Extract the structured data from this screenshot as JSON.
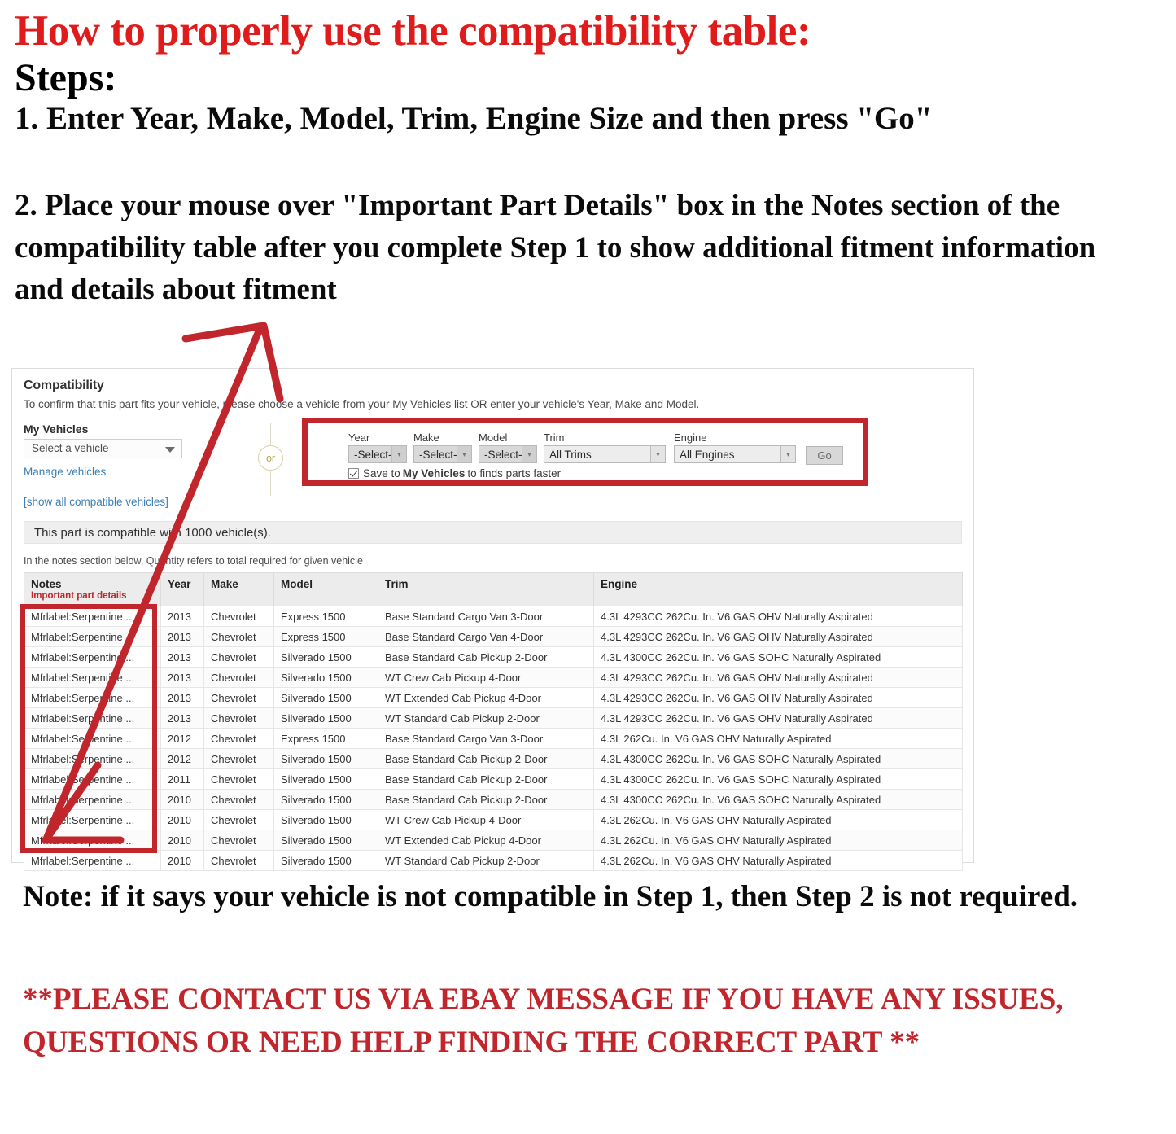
{
  "instructions": {
    "headline": "How to properly use the compatibility table:",
    "steps_label": "Steps:",
    "step_one": "1. Enter Year, Make, Model, Trim, Engine Size and then press \"Go\"",
    "step_two": "2. Place your mouse over \"Important Part Details\" box in the Notes section of the compatibility table after you complete Step 1 to show additional fitment information and details about fitment",
    "note": "Note: if it says your vehicle is not compatible in Step 1, then Step 2 is not required.",
    "contact": "**PLEASE CONTACT US VIA EBAY MESSAGE IF YOU HAVE ANY ISSUES, QUESTIONS OR NEED HELP FINDING THE CORRECT PART **"
  },
  "colors": {
    "red_accent": "#c0262b",
    "headline_red": "#e01b1b",
    "link_blue": "#3d7fb5",
    "banner_gray": "#efefef"
  },
  "compatibility": {
    "title": "Compatibility",
    "subtitle": "To confirm that this part fits your vehicle, please choose a vehicle from your My Vehicles list OR enter your vehicle's Year, Make and Model.",
    "my_vehicles": {
      "label": "My Vehicles",
      "select_value": "Select a vehicle",
      "manage_link": "Manage vehicles",
      "show_all_link": "[show all compatible vehicles]"
    },
    "or_divider": "or",
    "finder": {
      "year": {
        "label": "Year",
        "value": "-Select-"
      },
      "make": {
        "label": "Make",
        "value": "-Select-"
      },
      "model": {
        "label": "Model",
        "value": "-Select-"
      },
      "trim": {
        "label": "Trim",
        "value": "All Trims"
      },
      "engine": {
        "label": "Engine",
        "value": "All Engines"
      },
      "go_button": "Go",
      "save_prefix": "Save to",
      "save_bold": "My Vehicles",
      "save_suffix": "to finds parts faster",
      "save_checked": true
    },
    "banner": "This part is compatible with 1000 vehicle(s).",
    "notes_hint": "In the notes section below, Quantity refers to total required for given vehicle",
    "table": {
      "headers": {
        "notes": "Notes",
        "notes_sub": "Important part details",
        "year": "Year",
        "make": "Make",
        "model": "Model",
        "trim": "Trim",
        "engine": "Engine"
      },
      "rows": [
        {
          "notes": "Mfrlabel:Serpentine ...",
          "year": "2013",
          "make": "Chevrolet",
          "model": "Express 1500",
          "trim": "Base Standard Cargo Van 3-Door",
          "engine": "4.3L 4293CC 262Cu. In. V6 GAS OHV Naturally Aspirated"
        },
        {
          "notes": "Mfrlabel:Serpentine ...",
          "year": "2013",
          "make": "Chevrolet",
          "model": "Express 1500",
          "trim": "Base Standard Cargo Van 4-Door",
          "engine": "4.3L 4293CC 262Cu. In. V6 GAS OHV Naturally Aspirated"
        },
        {
          "notes": "Mfrlabel:Serpentine ...",
          "year": "2013",
          "make": "Chevrolet",
          "model": "Silverado 1500",
          "trim": "Base Standard Cab Pickup 2-Door",
          "engine": "4.3L 4300CC 262Cu. In. V6 GAS SOHC Naturally Aspirated"
        },
        {
          "notes": "Mfrlabel:Serpentine ...",
          "year": "2013",
          "make": "Chevrolet",
          "model": "Silverado 1500",
          "trim": "WT Crew Cab Pickup 4-Door",
          "engine": "4.3L 4293CC 262Cu. In. V6 GAS OHV Naturally Aspirated"
        },
        {
          "notes": "Mfrlabel:Serpentine ...",
          "year": "2013",
          "make": "Chevrolet",
          "model": "Silverado 1500",
          "trim": "WT Extended Cab Pickup 4-Door",
          "engine": "4.3L 4293CC 262Cu. In. V6 GAS OHV Naturally Aspirated"
        },
        {
          "notes": "Mfrlabel:Serpentine ...",
          "year": "2013",
          "make": "Chevrolet",
          "model": "Silverado 1500",
          "trim": "WT Standard Cab Pickup 2-Door",
          "engine": "4.3L 4293CC 262Cu. In. V6 GAS OHV Naturally Aspirated"
        },
        {
          "notes": "Mfrlabel:Serpentine ...",
          "year": "2012",
          "make": "Chevrolet",
          "model": "Express 1500",
          "trim": "Base Standard Cargo Van 3-Door",
          "engine": "4.3L 262Cu. In. V6 GAS OHV Naturally Aspirated"
        },
        {
          "notes": "Mfrlabel:Serpentine ...",
          "year": "2012",
          "make": "Chevrolet",
          "model": "Silverado 1500",
          "trim": "Base Standard Cab Pickup 2-Door",
          "engine": "4.3L 4300CC 262Cu. In. V6 GAS SOHC Naturally Aspirated"
        },
        {
          "notes": "Mfrlabel:Serpentine ...",
          "year": "2011",
          "make": "Chevrolet",
          "model": "Silverado 1500",
          "trim": "Base Standard Cab Pickup 2-Door",
          "engine": "4.3L 4300CC 262Cu. In. V6 GAS SOHC Naturally Aspirated"
        },
        {
          "notes": "Mfrlabel:Serpentine ...",
          "year": "2010",
          "make": "Chevrolet",
          "model": "Silverado 1500",
          "trim": "Base Standard Cab Pickup 2-Door",
          "engine": "4.3L 4300CC 262Cu. In. V6 GAS SOHC Naturally Aspirated"
        },
        {
          "notes": "Mfrlabel:Serpentine ...",
          "year": "2010",
          "make": "Chevrolet",
          "model": "Silverado 1500",
          "trim": "WT Crew Cab Pickup 4-Door",
          "engine": "4.3L 262Cu. In. V6 GAS OHV Naturally Aspirated"
        },
        {
          "notes": "Mfrlabel:Serpentine ...",
          "year": "2010",
          "make": "Chevrolet",
          "model": "Silverado 1500",
          "trim": "WT Extended Cab Pickup 4-Door",
          "engine": "4.3L 262Cu. In. V6 GAS OHV Naturally Aspirated"
        },
        {
          "notes": "Mfrlabel:Serpentine ...",
          "year": "2010",
          "make": "Chevrolet",
          "model": "Silverado 1500",
          "trim": "WT Standard Cab Pickup 2-Door",
          "engine": "4.3L 262Cu. In. V6 GAS OHV Naturally Aspirated"
        }
      ]
    }
  }
}
